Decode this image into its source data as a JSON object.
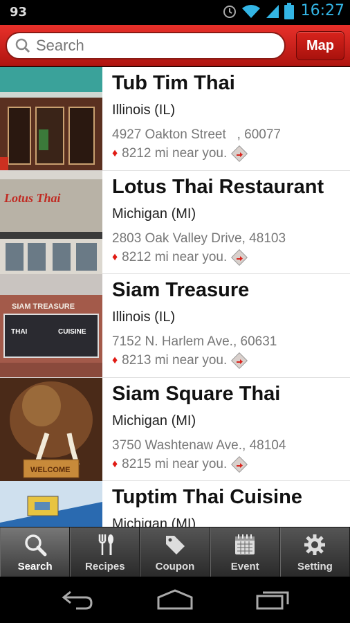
{
  "status_bar": {
    "notification": "93",
    "time": "16:27"
  },
  "header": {
    "search_placeholder": "Search",
    "map_label": "Map"
  },
  "restaurants": [
    {
      "name": "Tub Tim Thai",
      "state": "Illinois (IL)",
      "address": "4927 Oakton Street   , 60077",
      "distance": "8212 mi near you."
    },
    {
      "name": "Lotus Thai Restaurant",
      "state": "Michigan (MI)",
      "address": "2803 Oak Valley Drive, 48103",
      "distance": "8212 mi near you."
    },
    {
      "name": "Siam Treasure",
      "state": "Illinois (IL)",
      "address": "7152 N. Harlem Ave., 60631",
      "distance": "8213 mi near you."
    },
    {
      "name": "Siam Square Thai",
      "state": "Michigan (MI)",
      "address": "3750 Washtenaw Ave., 48104",
      "distance": "8215 mi near you."
    },
    {
      "name": "Tuptim Thai Cuisine",
      "state": "Michigan (MI)",
      "address": "",
      "distance": ""
    }
  ],
  "photo_signs": {
    "lotus": "Lotus Thai",
    "siam_treasure": "SIAM TREASURE",
    "thai": "THAI",
    "cuisine": "CUISINE",
    "welcome": "WELCOME"
  },
  "tabs": [
    {
      "label": "Search",
      "icon": "search-icon",
      "active": true
    },
    {
      "label": "Recipes",
      "icon": "fork-spoon-icon"
    },
    {
      "label": "Coupon",
      "icon": "tag-icon"
    },
    {
      "label": "Event",
      "icon": "calendar-icon"
    },
    {
      "label": "Setting",
      "icon": "gear-icon"
    }
  ],
  "colors": {
    "accent": "#d8231c",
    "clock": "#33b5e5",
    "pin": "#e01b14"
  }
}
